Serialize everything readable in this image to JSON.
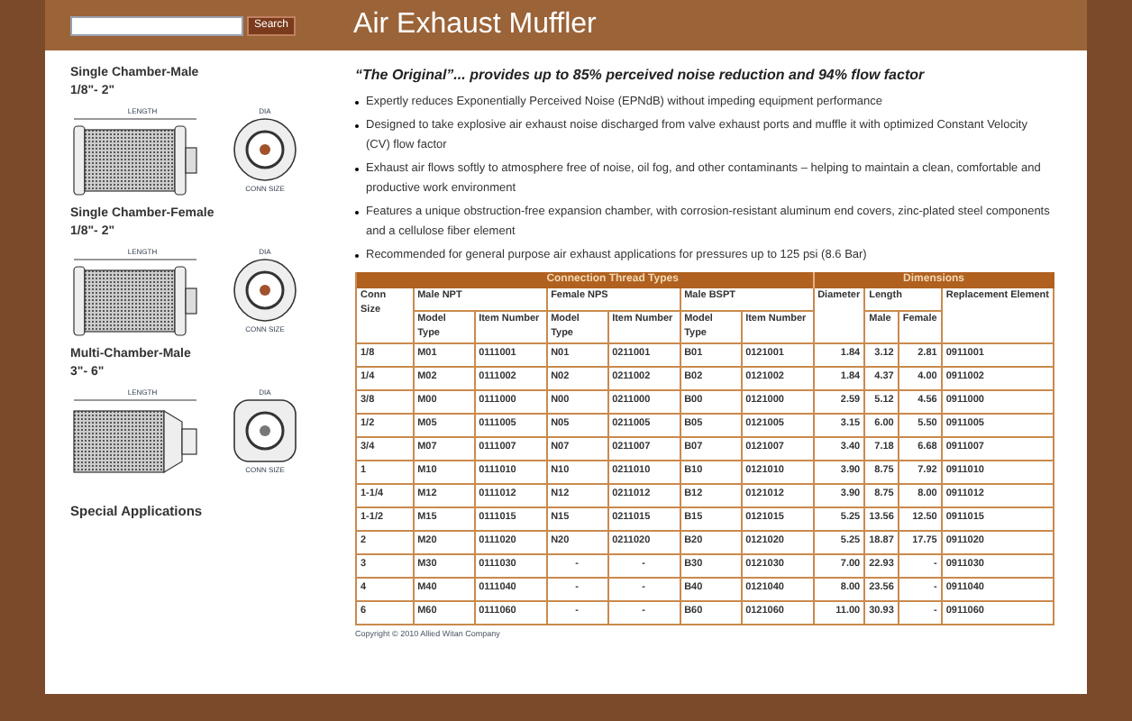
{
  "header": {
    "search_button": "Search",
    "title": "Air Exhaust Muffler"
  },
  "sidebar": {
    "sections": [
      {
        "kind": "single",
        "title": "Single Chamber-Male",
        "range": "1/8\"- 2\"",
        "length_label": "LENGTH",
        "dia_label": "DIA",
        "conn_label": "CONN SIZE"
      },
      {
        "kind": "single",
        "title": "Single Chamber-Female",
        "range": "1/8\"- 2\"",
        "length_label": "LENGTH",
        "dia_label": "DIA",
        "conn_label": "CONN SIZE"
      },
      {
        "kind": "multi",
        "title": "Multi-Chamber-Male",
        "range": "3\"- 6\"",
        "length_label": "LENGTH",
        "dia_label": "DIA",
        "conn_label": "CONN SIZE"
      }
    ],
    "link": "Special Applications"
  },
  "content": {
    "headline": "“The Original”... provides up to 85% perceived noise reduction and 94% flow factor",
    "bullets": [
      "Expertly reduces Exponentially Perceived Noise (EPNdB) without impeding equipment performance",
      "Designed to take explosive air exhaust noise discharged from valve exhaust ports and muffle it with optimized Constant Velocity (CV) flow factor",
      "Exhaust air flows softly to atmosphere free of noise, oil fog, and other contaminants – helping to maintain a clean, comfortable and productive work environment",
      "Features a unique obstruction-free expansion chamber, with corrosion-resistant aluminum end covers, zinc-plated steel components and a cellulose fiber element",
      "Recommended for general purpose air exhaust applications for pressures up to 125 psi (8.6 Bar)"
    ]
  },
  "table": {
    "group_headers": [
      "Connection Thread Types",
      "Dimensions"
    ],
    "conn_size": "Conn Size",
    "thread_types": [
      {
        "name": "Male NPT",
        "model_type": "Model Type",
        "item_number": "Item Number"
      },
      {
        "name": "Female NPS",
        "model_type": "Model Type",
        "item_number": "Item Number"
      },
      {
        "name": "Male BSPT",
        "model_type": "Model Type",
        "item_number": "Item Number"
      }
    ],
    "diameter": "Diameter",
    "length": "Length",
    "length_male": "Male",
    "length_female": "Female",
    "replacement": "Replacement Element",
    "rows": [
      [
        "1/8",
        "M01",
        "0111001",
        "N01",
        "0211001",
        "B01",
        "0121001",
        "1.84",
        "3.12",
        "2.81",
        "0911001"
      ],
      [
        "1/4",
        "M02",
        "0111002",
        "N02",
        "0211002",
        "B02",
        "0121002",
        "1.84",
        "4.37",
        "4.00",
        "0911002"
      ],
      [
        "3/8",
        "M00",
        "0111000",
        "N00",
        "0211000",
        "B00",
        "0121000",
        "2.59",
        "5.12",
        "4.56",
        "0911000"
      ],
      [
        "1/2",
        "M05",
        "0111005",
        "N05",
        "0211005",
        "B05",
        "0121005",
        "3.15",
        "6.00",
        "5.50",
        "0911005"
      ],
      [
        "3/4",
        "M07",
        "0111007",
        "N07",
        "0211007",
        "B07",
        "0121007",
        "3.40",
        "7.18",
        "6.68",
        "0911007"
      ],
      [
        "1",
        "M10",
        "0111010",
        "N10",
        "0211010",
        "B10",
        "0121010",
        "3.90",
        "8.75",
        "7.92",
        "0911010"
      ],
      [
        "1-1/4",
        "M12",
        "0111012",
        "N12",
        "0211012",
        "B12",
        "0121012",
        "3.90",
        "8.75",
        "8.00",
        "0911012"
      ],
      [
        "1-1/2",
        "M15",
        "0111015",
        "N15",
        "0211015",
        "B15",
        "0121015",
        "5.25",
        "13.56",
        "12.50",
        "0911015"
      ],
      [
        "2",
        "M20",
        "0111020",
        "N20",
        "0211020",
        "B20",
        "0121020",
        "5.25",
        "18.87",
        "17.75",
        "0911020"
      ],
      [
        "3",
        "M30",
        "0111030",
        "-",
        "-",
        "B30",
        "0121030",
        "7.00",
        "22.93",
        "-",
        "0911030"
      ],
      [
        "4",
        "M40",
        "0111040",
        "-",
        "-",
        "B40",
        "0121040",
        "8.00",
        "23.56",
        "-",
        "0911040"
      ],
      [
        "6",
        "M60",
        "0111060",
        "-",
        "-",
        "B60",
        "0121060",
        "11.00",
        "30.93",
        "-",
        "0911060"
      ]
    ],
    "copyright": "Copyright © 2010 Allied Witan Company"
  }
}
